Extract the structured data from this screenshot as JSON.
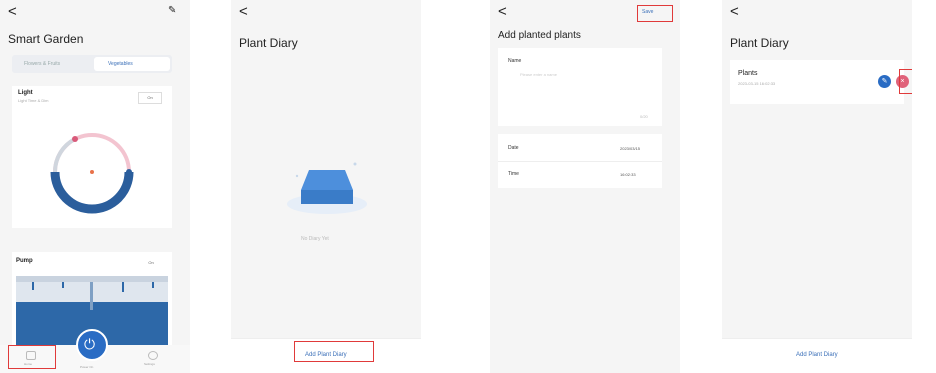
{
  "screen1": {
    "back": "<",
    "title": "Smart Garden",
    "edit_icon": "edit-icon",
    "tabs": [
      {
        "label": "Flowers & Fruits"
      },
      {
        "label": "Vegetables"
      }
    ],
    "light": {
      "title": "Light",
      "subtitle": "Light Time & Dim",
      "button": "On"
    },
    "pump": {
      "title": "Pump",
      "button": "On"
    },
    "nav": {
      "left_label": "Home",
      "center_label": "Power On",
      "right_label": "Settings"
    },
    "colors": {
      "accent": "#2a6cc4",
      "ring_dark": "#2b5e9c",
      "ring_pink": "#f3c4d0",
      "highlight": "#e03a3a"
    }
  },
  "screen2": {
    "back": "<",
    "title": "Plant Diary",
    "empty_label": "No Diary Yet",
    "add_button": "Add Plant Diary"
  },
  "screen3": {
    "back": "<",
    "title": "Add planted plants",
    "save": "Save",
    "name_label": "Name",
    "name_placeholder": "Please enter a name",
    "counter": "0/20",
    "date_label": "Date",
    "date_value": "2023/03/15",
    "time_label": "Time",
    "time_value": "16:02:33"
  },
  "screen4": {
    "back": "<",
    "title": "Plant Diary",
    "entry_title": "Plants",
    "entry_date": "2023-03-15 16:02:33",
    "edit_icon": "edit-icon",
    "delete_icon": "delete-icon",
    "add_button": "Add Plant Diary"
  }
}
